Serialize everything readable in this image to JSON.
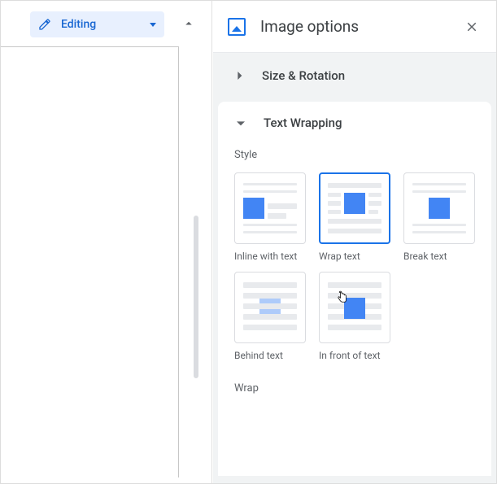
{
  "editingMode": {
    "label": "Editing"
  },
  "panel": {
    "title": "Image options",
    "sections": {
      "sizeRotation": {
        "title": "Size & Rotation"
      },
      "textWrapping": {
        "title": "Text Wrapping",
        "styleLabel": "Style",
        "wrapLabel": "Wrap",
        "options": {
          "inline": "Inline with text",
          "wrap": "Wrap text",
          "break": "Break text",
          "behind": "Behind text",
          "front": "In front of text"
        },
        "selected": "wrap"
      }
    }
  }
}
